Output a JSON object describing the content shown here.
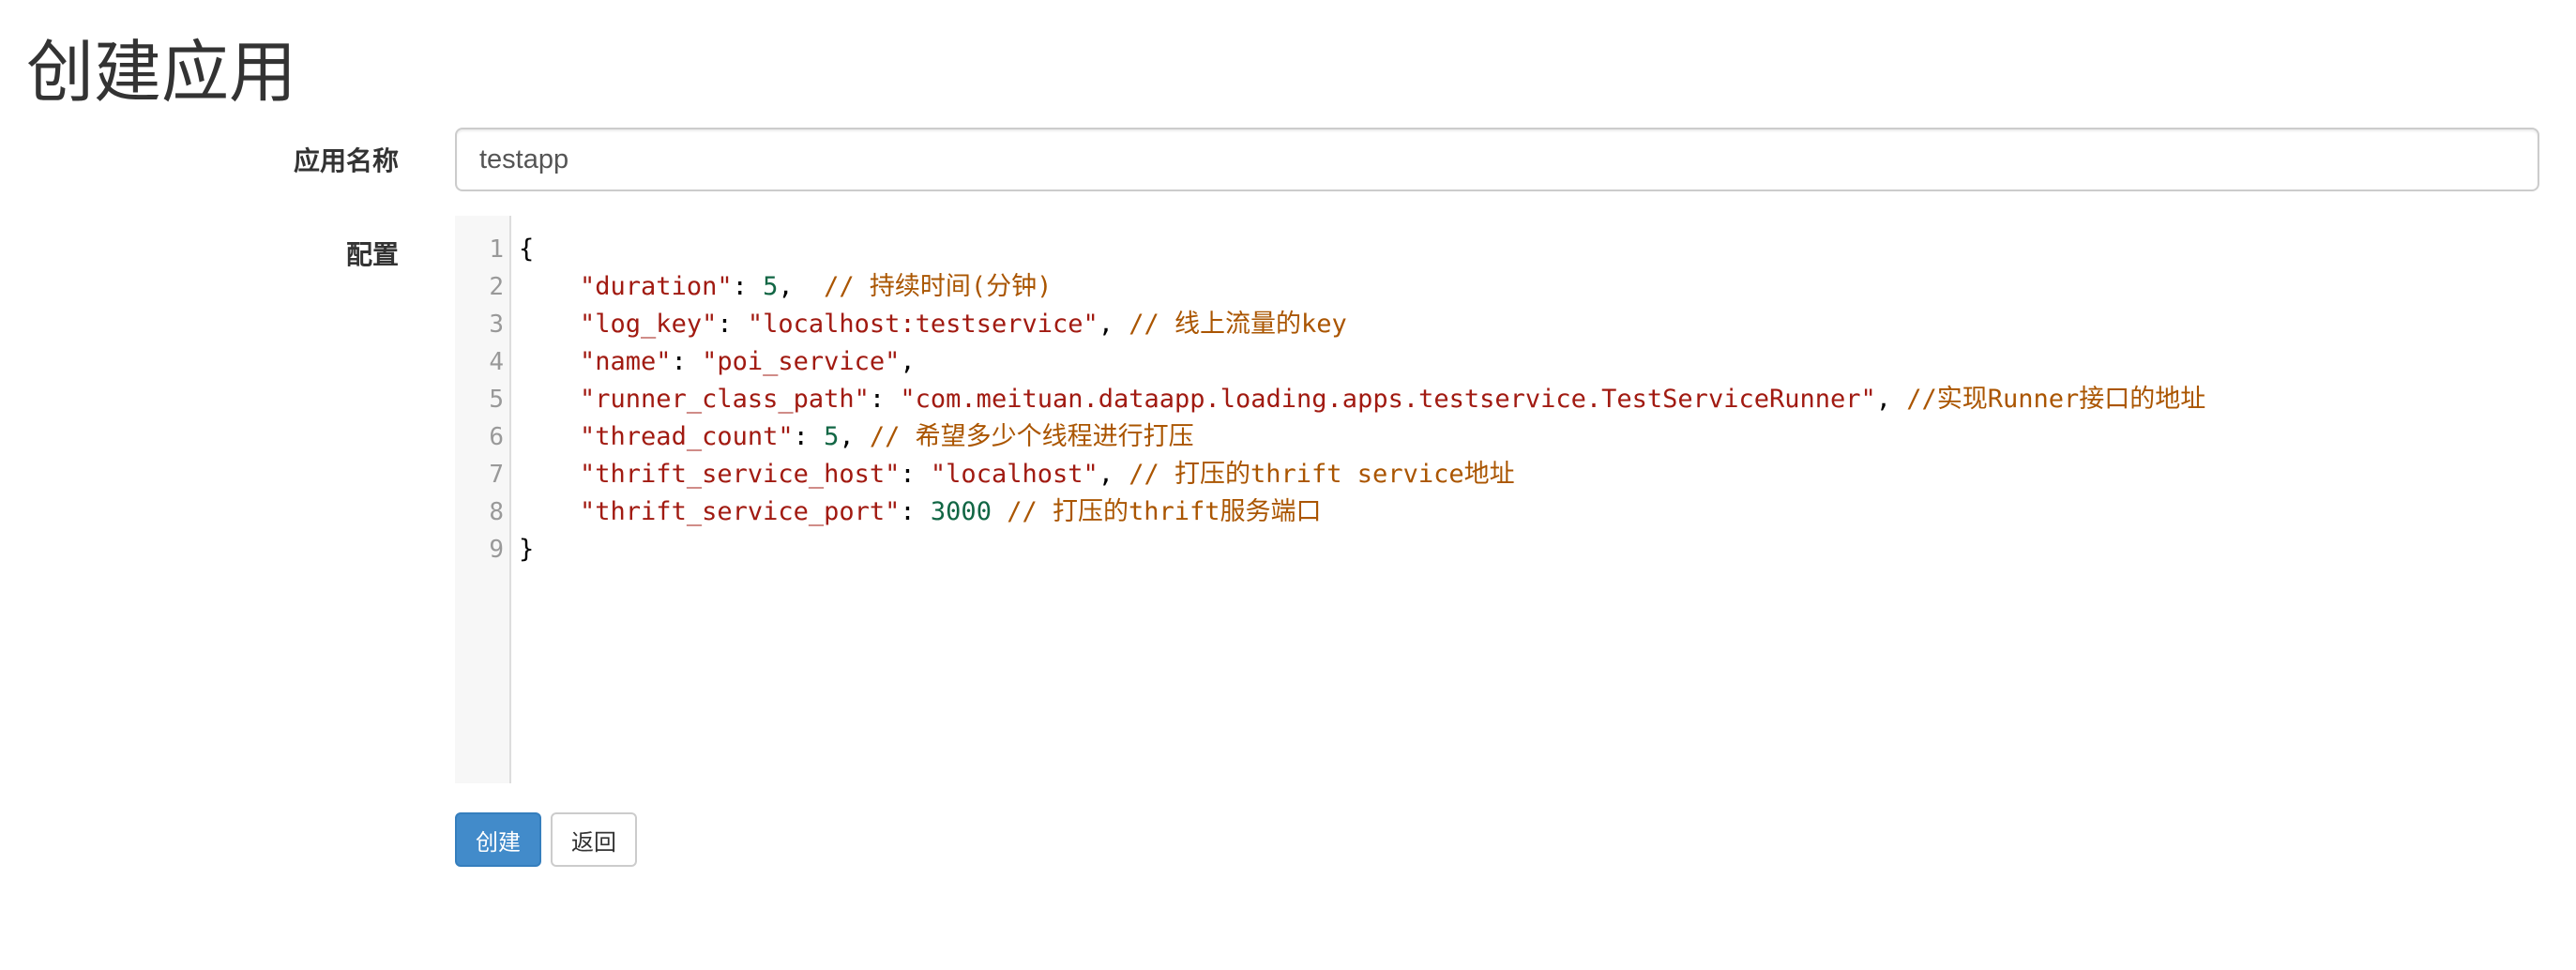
{
  "page": {
    "title": "创建应用"
  },
  "form": {
    "name_label": "应用名称",
    "name_value": "testapp",
    "config_label": "配置"
  },
  "editor": {
    "lines": [
      {
        "no": "1",
        "tokens": [
          {
            "t": "punct",
            "v": "{"
          }
        ]
      },
      {
        "no": "2",
        "tokens": [
          {
            "t": "punct",
            "v": "    "
          },
          {
            "t": "key",
            "v": "\"duration\""
          },
          {
            "t": "punct",
            "v": ": "
          },
          {
            "t": "num",
            "v": "5"
          },
          {
            "t": "punct",
            "v": ",  "
          },
          {
            "t": "comment",
            "v": "// 持续时间(分钟)"
          }
        ]
      },
      {
        "no": "3",
        "tokens": [
          {
            "t": "punct",
            "v": "    "
          },
          {
            "t": "key",
            "v": "\"log_key\""
          },
          {
            "t": "punct",
            "v": ": "
          },
          {
            "t": "str",
            "v": "\"localhost:testservice\""
          },
          {
            "t": "punct",
            "v": ", "
          },
          {
            "t": "comment",
            "v": "// 线上流量的key"
          }
        ]
      },
      {
        "no": "4",
        "tokens": [
          {
            "t": "punct",
            "v": "    "
          },
          {
            "t": "key",
            "v": "\"name\""
          },
          {
            "t": "punct",
            "v": ": "
          },
          {
            "t": "str",
            "v": "\"poi_service\""
          },
          {
            "t": "punct",
            "v": ","
          }
        ]
      },
      {
        "no": "5",
        "tokens": [
          {
            "t": "punct",
            "v": "    "
          },
          {
            "t": "key",
            "v": "\"runner_class_path\""
          },
          {
            "t": "punct",
            "v": ": "
          },
          {
            "t": "str",
            "v": "\"com.meituan.dataapp.loading.apps.testservice.TestServiceRunner\""
          },
          {
            "t": "punct",
            "v": ", "
          },
          {
            "t": "comment",
            "v": "//实现Runner接口的地址"
          }
        ]
      },
      {
        "no": "6",
        "tokens": [
          {
            "t": "punct",
            "v": "    "
          },
          {
            "t": "key",
            "v": "\"thread_count\""
          },
          {
            "t": "punct",
            "v": ": "
          },
          {
            "t": "num",
            "v": "5"
          },
          {
            "t": "punct",
            "v": ", "
          },
          {
            "t": "comment",
            "v": "// 希望多少个线程进行打压"
          }
        ]
      },
      {
        "no": "7",
        "tokens": [
          {
            "t": "punct",
            "v": "    "
          },
          {
            "t": "key",
            "v": "\"thrift_service_host\""
          },
          {
            "t": "punct",
            "v": ": "
          },
          {
            "t": "str",
            "v": "\"localhost\""
          },
          {
            "t": "punct",
            "v": ", "
          },
          {
            "t": "comment",
            "v": "// 打压的thrift service地址"
          }
        ]
      },
      {
        "no": "8",
        "tokens": [
          {
            "t": "punct",
            "v": "    "
          },
          {
            "t": "key",
            "v": "\"thrift_service_port\""
          },
          {
            "t": "punct",
            "v": ": "
          },
          {
            "t": "num",
            "v": "3000"
          },
          {
            "t": "punct",
            "v": " "
          },
          {
            "t": "comment",
            "v": "// 打压的thrift服务端口"
          }
        ]
      },
      {
        "no": "9",
        "tokens": [
          {
            "t": "punct",
            "v": "}"
          }
        ]
      }
    ]
  },
  "buttons": {
    "create_label": "创建",
    "back_label": "返回"
  },
  "colors": {
    "primary": "#428bca",
    "key_string": "#a11a11",
    "number": "#116644",
    "comment": "#aa5500"
  }
}
